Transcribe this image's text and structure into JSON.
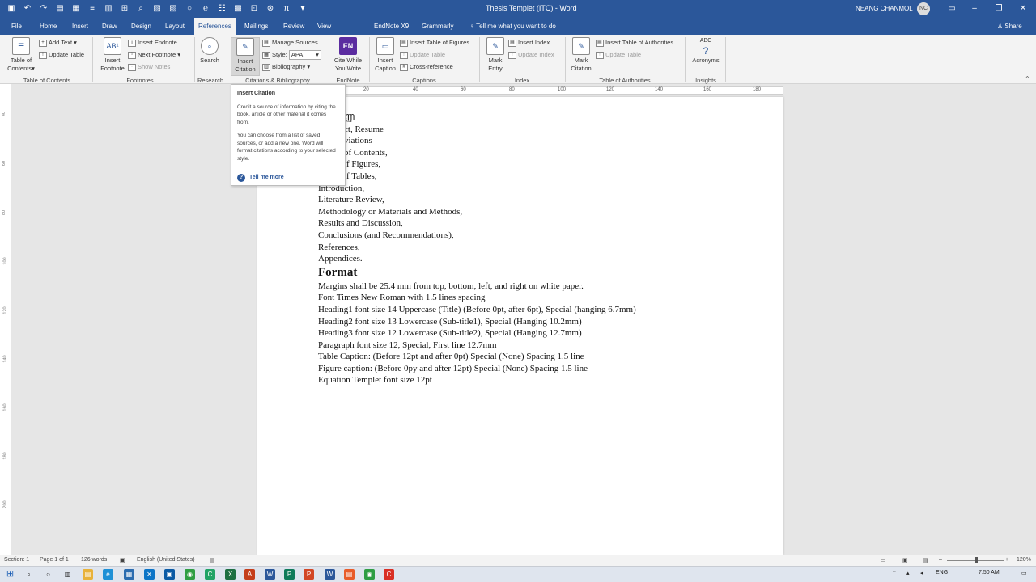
{
  "window": {
    "title": "Thesis Templet (ITC) - Word",
    "user": "NEANG CHANMOL",
    "user_initials": "NC",
    "share": "Share",
    "tell_me": "Tell me what you want to do",
    "accent": "#2b579a"
  },
  "tabs": [
    "File",
    "Home",
    "Insert",
    "Draw",
    "Design",
    "Layout",
    "References",
    "Mailings",
    "Review",
    "View",
    "EndNote X9",
    "Grammarly"
  ],
  "active_tab": "References",
  "ribbon": {
    "toc": {
      "label": "Table of Contents",
      "button": "Table of Contents",
      "add_text": "Add Text",
      "update_table": "Update Table"
    },
    "footnotes": {
      "label": "Footnotes",
      "insert_footnote": "Insert Footnote",
      "insert_endnote": "Insert Endnote",
      "next_footnote": "Next Footnote",
      "show_notes": "Show Notes"
    },
    "research": {
      "label": "Research",
      "search": "Search"
    },
    "citations": {
      "label": "Citations & Bibliography",
      "insert_citation": "Insert Citation",
      "manage_sources": "Manage Sources",
      "style_label": "Style:",
      "style_value": "APA",
      "bibliography": "Bibliography"
    },
    "endnote": {
      "label": "EndNote",
      "cite_while": "Cite While You Write",
      "en_badge": "EN"
    },
    "captions": {
      "label": "Captions",
      "insert_caption": "Insert Caption",
      "insert_tof": "Insert Table of Figures",
      "update_table": "Update Table",
      "cross_reference": "Cross-reference"
    },
    "index": {
      "label": "Index",
      "mark_entry": "Mark Entry",
      "insert_index": "Insert Index",
      "update_index": "Update Index"
    },
    "toa": {
      "label": "Table of Authorities",
      "mark_citation": "Mark Citation",
      "insert_toa": "Insert Table of Authorities",
      "update_table": "Update Table"
    },
    "insights": {
      "label": "Insights",
      "acronyms": "Acronyms",
      "abc": "ABC"
    }
  },
  "tooltip": {
    "title": "Insert Citation",
    "p1": "Credit a source of information by citing the book, article or other material it comes from.",
    "p2": "You can choose from a list of saved sources, or add a new one. Word will format citations according to your selected style.",
    "more": "Tell me more"
  },
  "document": {
    "lines": [
      "ញ្ញា",
      "ct,  Resume",
      "viations",
      "of Contents,",
      "f Figures,",
      "f Tables,",
      "Introduction,",
      "Literature Review,",
      "Methodology or Materials and Methods,",
      "Results and Discussion,",
      "Conclusions (and Recommendations),",
      "References,",
      "Appendices."
    ],
    "heading": "Format",
    "format_lines": [
      "Margins shall be 25.4 mm from top, bottom, left, and right on white paper.",
      "Font Times New Roman with 1.5 lines spacing",
      "Heading1 font size 14 Uppercase (Title) (Before 0pt, after 6pt), Special (hanging 6.7mm)",
      "Heading2 font size 13 Lowercase (Sub-title1), Special (Hanging 10.2mm)",
      "Heading3 font size 12 Lowercase (Sub-title2), Special (Hanging 12.7mm)",
      "Paragraph font size 12, Special, First line 12.7mm",
      "Table Caption: (Before 12pt and after 0pt) Special (None) Spacing 1.5 line",
      "Figure caption: (Before 0py and after 12pt) Special (None) Spacing 1.5 line",
      "Equation Templet font size 12pt"
    ]
  },
  "ruler_h": [
    "20",
    "40",
    "60",
    "80",
    "100",
    "120",
    "140",
    "160",
    "180"
  ],
  "ruler_v": [
    "40",
    "60",
    "80",
    "100",
    "120",
    "140",
    "160",
    "180",
    "200"
  ],
  "status": {
    "section": "Section: 1",
    "page": "Page 1 of 1",
    "words": "126 words",
    "language": "English (United States)",
    "zoom": "120%"
  },
  "taskbar": {
    "lang": "ENG",
    "time": "7:50 AM"
  }
}
